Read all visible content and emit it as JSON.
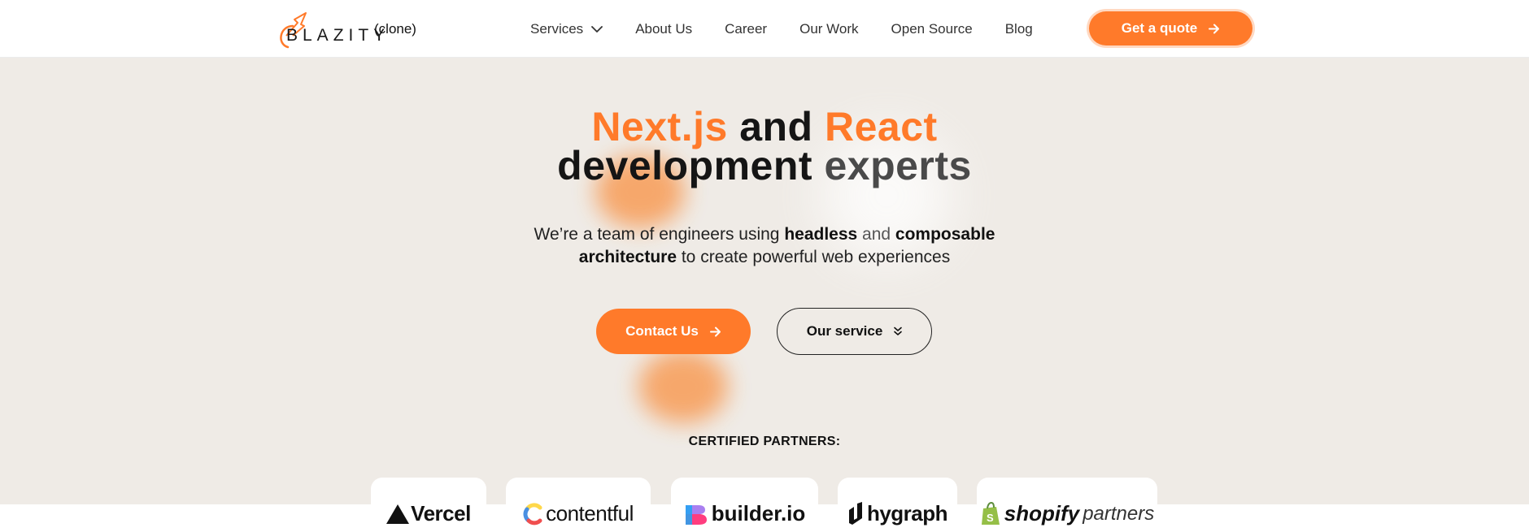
{
  "brand": {
    "name": "BLAZITY",
    "suffix": "(clone)",
    "accent": "#ff7a2a"
  },
  "nav": {
    "items": [
      {
        "label": "Services",
        "icon": "chevron-down-icon"
      },
      {
        "label": "About Us"
      },
      {
        "label": "Career"
      },
      {
        "label": "Our Work"
      },
      {
        "label": "Open Source"
      },
      {
        "label": "Blog"
      }
    ],
    "cta_label": "Get a quote",
    "cta_icon": "arrow-right-icon"
  },
  "hero": {
    "title_line1": {
      "part1": "Next.js",
      "part2": " and ",
      "part3": "React"
    },
    "title_line2": {
      "part1": "development ",
      "part2": "experts"
    },
    "subtitle_line1": {
      "part1": "We’re a team of engineers using ",
      "part2": "headless",
      "part3": " and ",
      "part4": "composable"
    },
    "subtitle_line2": {
      "part1": "architecture",
      "part2": " to create powerful web experiences"
    },
    "primary_button": "Contact Us",
    "secondary_button": "Our service",
    "background": "#efebe6"
  },
  "partners": {
    "title": "CERTIFIED PARTNERS:",
    "items": [
      {
        "name": "Vercel",
        "icon": "vercel-triangle-icon"
      },
      {
        "name": "contentful",
        "icon": "contentful-icon"
      },
      {
        "name": "builder.io",
        "icon": "builder-icon"
      },
      {
        "name": "hygraph",
        "icon": "hygraph-icon"
      },
      {
        "name": "shopify",
        "suffix": "partners",
        "icon": "shopify-bag-icon"
      }
    ]
  }
}
